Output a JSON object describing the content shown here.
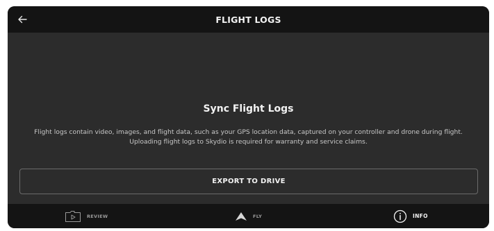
{
  "header": {
    "title": "FLIGHT LOGS",
    "back_icon": "arrow-left-icon"
  },
  "main": {
    "heading": "Sync Flight Logs",
    "description": "Flight logs contain video, images, and flight data, such as your GPS location data, captured on your controller and drone during flight. Uploading flight logs to Skydio is required for warranty and service claims.",
    "export_button_label": "EXPORT TO DRIVE"
  },
  "tabbar": {
    "items": [
      {
        "label": "REVIEW",
        "icon": "play-folder-icon",
        "active": false
      },
      {
        "label": "FLY",
        "icon": "navigation-arrow-icon",
        "active": false
      },
      {
        "label": "INFO",
        "icon": "info-circle-icon",
        "active": true
      }
    ]
  },
  "colors": {
    "background": "#2c2c2c",
    "bar": "#141414",
    "text": "#f2f2f2",
    "muted": "#9a9a9a"
  }
}
